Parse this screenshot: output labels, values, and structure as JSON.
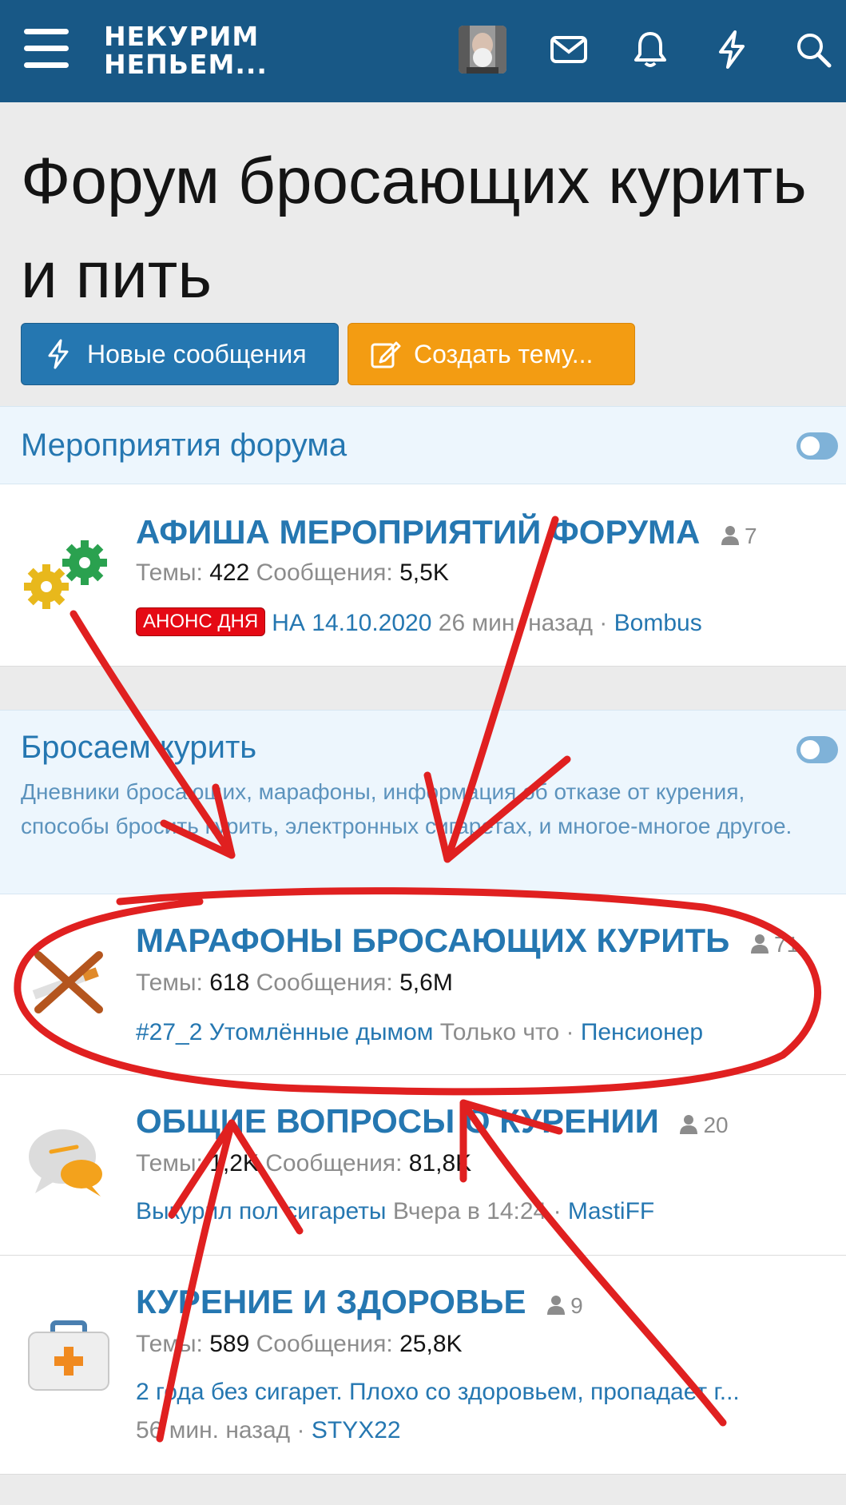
{
  "header": {
    "logo_line1": "НЕКУРИМ",
    "logo_line2": "НЕПЬЕМ...",
    "icons": [
      "menu-icon",
      "avatar",
      "mail-icon",
      "bell-icon",
      "bolt-icon",
      "search-icon"
    ]
  },
  "page": {
    "title": "Форум бросающих курить и пить",
    "btn_new": "Новые сообщения",
    "btn_create": "Создать тему..."
  },
  "categories": [
    {
      "title": "Мероприятия форума",
      "nodes": [
        {
          "title": "АФИША МЕРОПРИЯТИЙ ФОРУМА",
          "users": "7",
          "stats_topics_label": "Темы:",
          "stats_topics": "422",
          "stats_posts_label": "Сообщения:",
          "stats_posts": "5,5K",
          "prefix": "АНОНС ДНЯ",
          "last_thread": "НА 14.10.2020",
          "last_time": "26 мин. назад",
          "sep": "·",
          "last_user": "Bombus",
          "icon": "gears-icon"
        }
      ]
    },
    {
      "title": "Бросаем курить",
      "description": "Дневники бросающих, марафоны, информация об отказе от курения, способы бросить курить, электронных сигаретах, и многое-многое другое.",
      "nodes": [
        {
          "title": "МАРАФОНЫ БРОСАЮЩИХ КУРИТЬ",
          "users": "71",
          "stats_topics_label": "Темы:",
          "stats_topics": "618",
          "stats_posts_label": "Сообщения:",
          "stats_posts": "5,6M",
          "last_thread": "#27_2 Утомлённые дымом",
          "last_time": "Только что",
          "sep": "·",
          "last_user": "Пенсионер",
          "icon": "crossed-cigarette-icon"
        },
        {
          "title": "ОБЩИЕ ВОПРОСЫ О КУРЕНИИ",
          "users": "20",
          "stats_topics_label": "Темы:",
          "stats_topics": "1,2K",
          "stats_posts_label": "Сообщения:",
          "stats_posts": "81,8K",
          "last_thread": "Выкурил пол сигареты",
          "last_time": "Вчера в 14:24",
          "sep": "·",
          "last_user": "MastiFF",
          "icon": "speech-bubbles-icon"
        },
        {
          "title": "КУРЕНИЕ И ЗДОРОВЬЕ",
          "users": "9",
          "stats_topics_label": "Темы:",
          "stats_topics": "589",
          "stats_posts_label": "Сообщения:",
          "stats_posts": "25,8K",
          "last_thread": "2 года без сигарет. Плохо со здоровьем, пропадает г...",
          "last_time": "56 мин. назад",
          "sep": "·",
          "last_user": "STYX22",
          "icon": "first-aid-kit-icon"
        }
      ]
    }
  ],
  "colors": {
    "header_bg": "#185886",
    "link": "#2577b1",
    "accent_orange": "#f39c12",
    "annotation_red": "#e02020"
  }
}
